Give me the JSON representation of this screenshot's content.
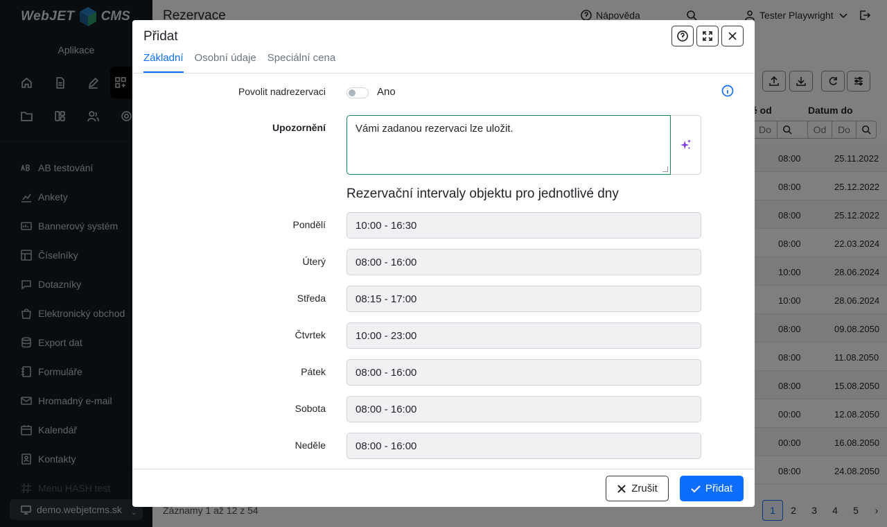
{
  "sidebar": {
    "logo": {
      "left": "WebJET",
      "right": "CMS"
    },
    "apps_label": "Aplikace",
    "icons": [
      "home-icon",
      "document-icon",
      "pencil-icon",
      "apps-icon",
      "folder-icon",
      "layout-icon",
      "users-icon",
      "gear-icon"
    ],
    "items": [
      {
        "label": "AB testování",
        "icon": "ab-icon"
      },
      {
        "label": "Ankety",
        "icon": "chart-icon"
      },
      {
        "label": "Bannerový systém",
        "icon": "banner-icon"
      },
      {
        "label": "Číselníky",
        "icon": "table-icon"
      },
      {
        "label": "Dotazníky",
        "icon": "chat-icon"
      },
      {
        "label": "Elektronický obchod",
        "icon": "bag-icon"
      },
      {
        "label": "Export dat",
        "icon": "database-icon"
      },
      {
        "label": "Formuláře",
        "icon": "form-icon"
      },
      {
        "label": "Hromadný e-mail",
        "icon": "mail-icon"
      },
      {
        "label": "Kalendář",
        "icon": "calendar-icon"
      },
      {
        "label": "Kontakty",
        "icon": "contact-icon"
      },
      {
        "label": "Menu HASH test",
        "icon": "hash-icon"
      }
    ],
    "domain": "demo.webjetcms.sk"
  },
  "topbar": {
    "title": "Rezervace",
    "help": "Nápověda",
    "user": "Tester Playwright"
  },
  "table": {
    "col_from": "Čas od",
    "col_from_visible": "ě od",
    "col_to": "Datum do",
    "filter_od": "Od",
    "filter_do": "Do",
    "rows": [
      {
        "time": "08:00",
        "date": "25.11.2022"
      },
      {
        "time": "08:00",
        "date": "25.12.2022"
      },
      {
        "time": "08:00",
        "date": "25.12.2022"
      },
      {
        "time": "08:00",
        "date": "22.03.2024"
      },
      {
        "time": "10:00",
        "date": "28.06.2024"
      },
      {
        "time": "10:00",
        "date": "28.06.2024"
      },
      {
        "time": "08:00",
        "date": "09.08.2050"
      },
      {
        "time": "08:00",
        "date": "11.08.2050"
      },
      {
        "time": "08:00",
        "date": "15.08.2050"
      },
      {
        "time": "00:00",
        "date": "12.08.2050"
      },
      {
        "time": "00:00",
        "date": "16.08.2050"
      },
      {
        "time": "08:00",
        "date": "24.08.2050"
      }
    ],
    "records": "Záznamy 1 až 12 z 54",
    "pages": [
      "1",
      "2",
      "3",
      "4",
      "5"
    ]
  },
  "modal": {
    "title": "Přidat",
    "tabs": [
      "Základní",
      "Osobní údaje",
      "Speciální cena"
    ],
    "active_tab": "Základní",
    "overbooking": {
      "label": "Povolit nadrezervaci",
      "toggle_label": "Ano",
      "checked": false
    },
    "warning": {
      "label": "Upozornění",
      "value": "Vámi zadanou rezervaci lze uložit."
    },
    "intervals_title": "Rezervační intervaly objektu pro jednotlivé dny",
    "days": [
      {
        "label": "Pondělí",
        "value": "10:00 - 16:30"
      },
      {
        "label": "Úterý",
        "value": "08:00 - 16:00"
      },
      {
        "label": "Středa",
        "value": "08:15 - 17:00"
      },
      {
        "label": "Čtvrtek",
        "value": "10:00 - 23:00"
      },
      {
        "label": "Pátek",
        "value": "08:00 - 16:00"
      },
      {
        "label": "Sobota",
        "value": "08:00 - 16:00"
      },
      {
        "label": "Neděle",
        "value": "08:00 - 16:00"
      }
    ],
    "cancel_label": "Zrušit",
    "submit_label": "Přidat"
  },
  "colors": {
    "accent": "#0d6efd",
    "sidebar_bg": "#141a21",
    "valid_border": "#198754",
    "ai_icon": "#7b3fe4"
  }
}
